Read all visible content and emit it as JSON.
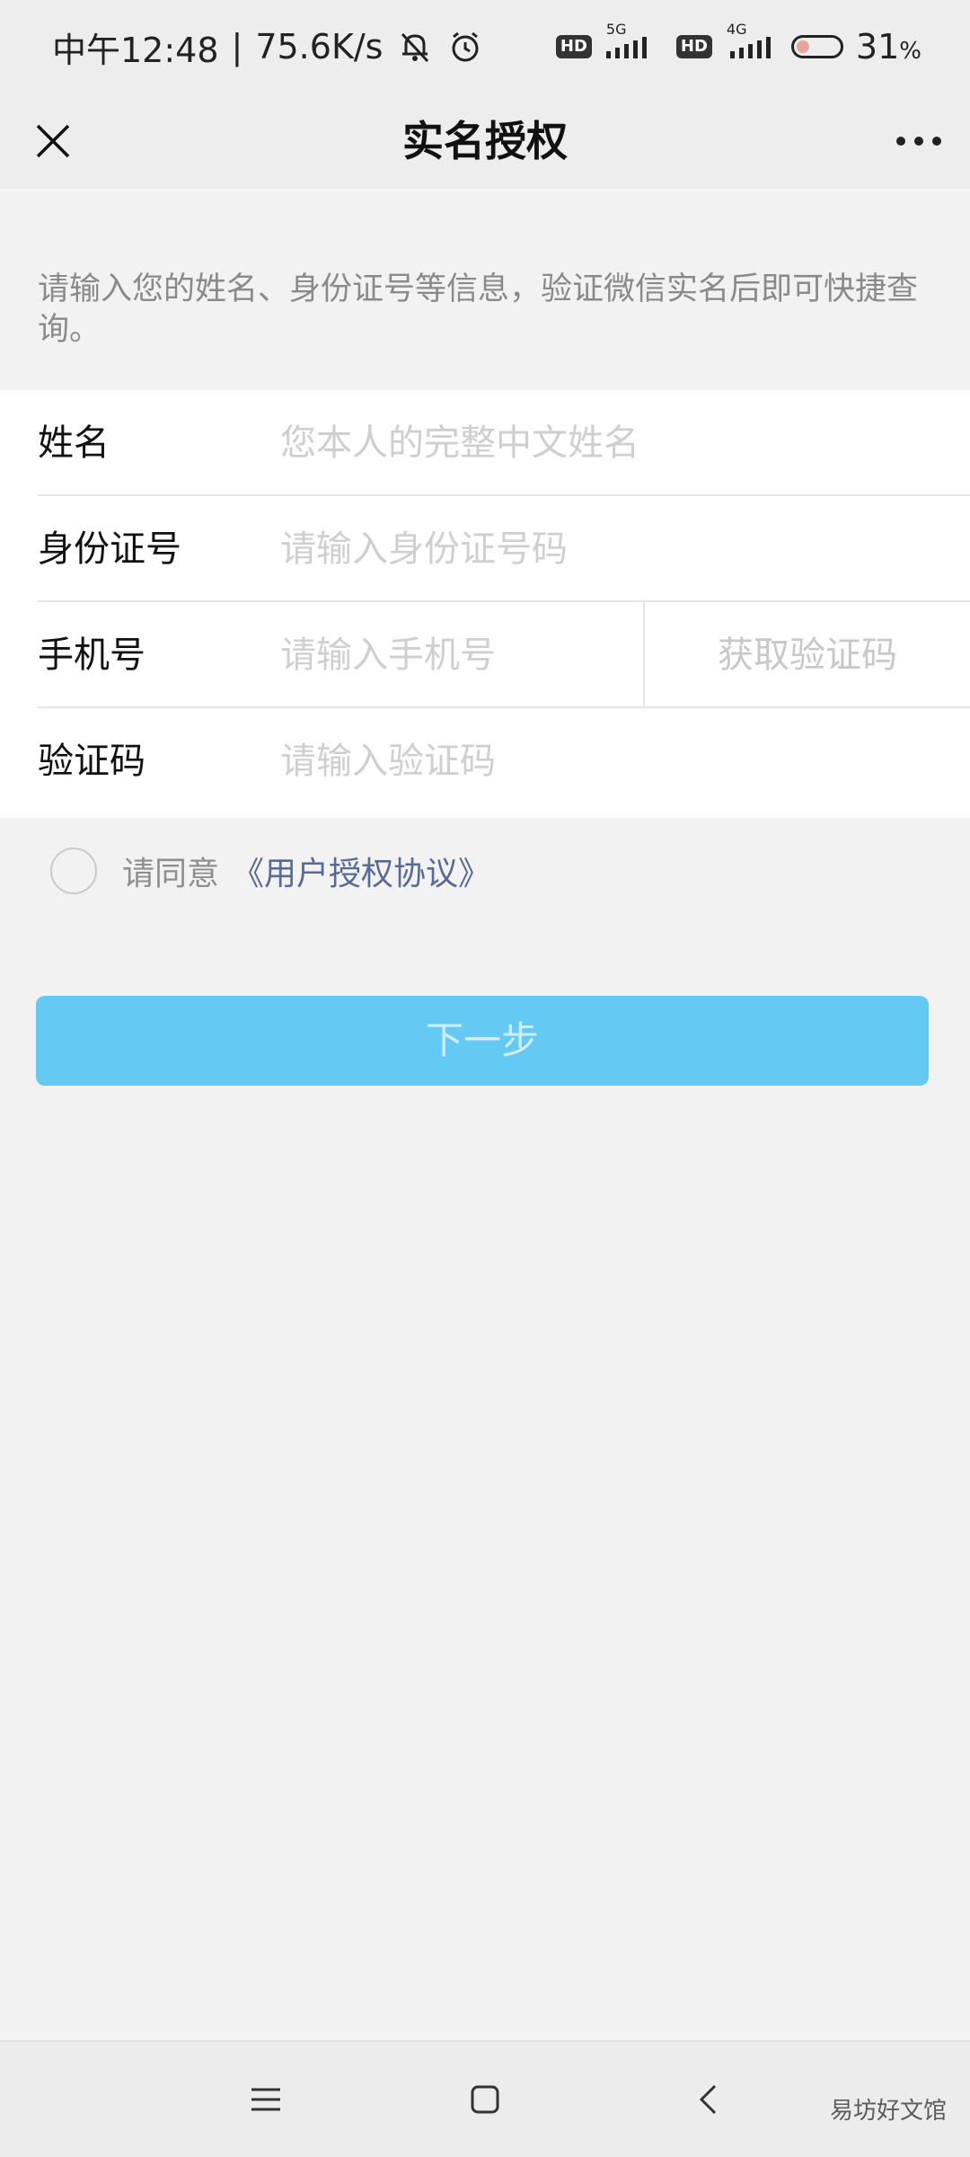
{
  "status_bar": {
    "time": "中午12:48",
    "separator": "|",
    "speed": "75.6K/s",
    "battery_level": "31",
    "battery_unit": "%",
    "net1": "5G",
    "net2": "4G",
    "hd_badge": "HD"
  },
  "header": {
    "title": "实名授权",
    "close_icon": "close-icon",
    "more_icon": "more-icon"
  },
  "description": "请输入您的姓名、身份证号等信息，验证微信实名后即可快捷查询。",
  "form": {
    "name": {
      "label": "姓名",
      "value": "",
      "placeholder": "您本人的完整中文姓名"
    },
    "id_number": {
      "label": "身份证号",
      "value": "",
      "placeholder": "请输入身份证号码"
    },
    "phone": {
      "label": "手机号",
      "value": "",
      "placeholder": "请输入手机号",
      "get_code_label": "获取验证码"
    },
    "code": {
      "label": "验证码",
      "value": "",
      "placeholder": "请输入验证码"
    }
  },
  "agreement": {
    "prefix": "请同意",
    "link": "《用户授权协议》",
    "checked": false
  },
  "next_button": "下一步",
  "nav": {
    "menu_icon": "menu-icon",
    "home_icon": "home-square-icon",
    "back_icon": "back-chevron-icon"
  },
  "watermark": "易坊好文馆",
  "colors": {
    "primary_button": "#64c9f3",
    "link": "#576b95",
    "background": "#f2f2f2"
  }
}
